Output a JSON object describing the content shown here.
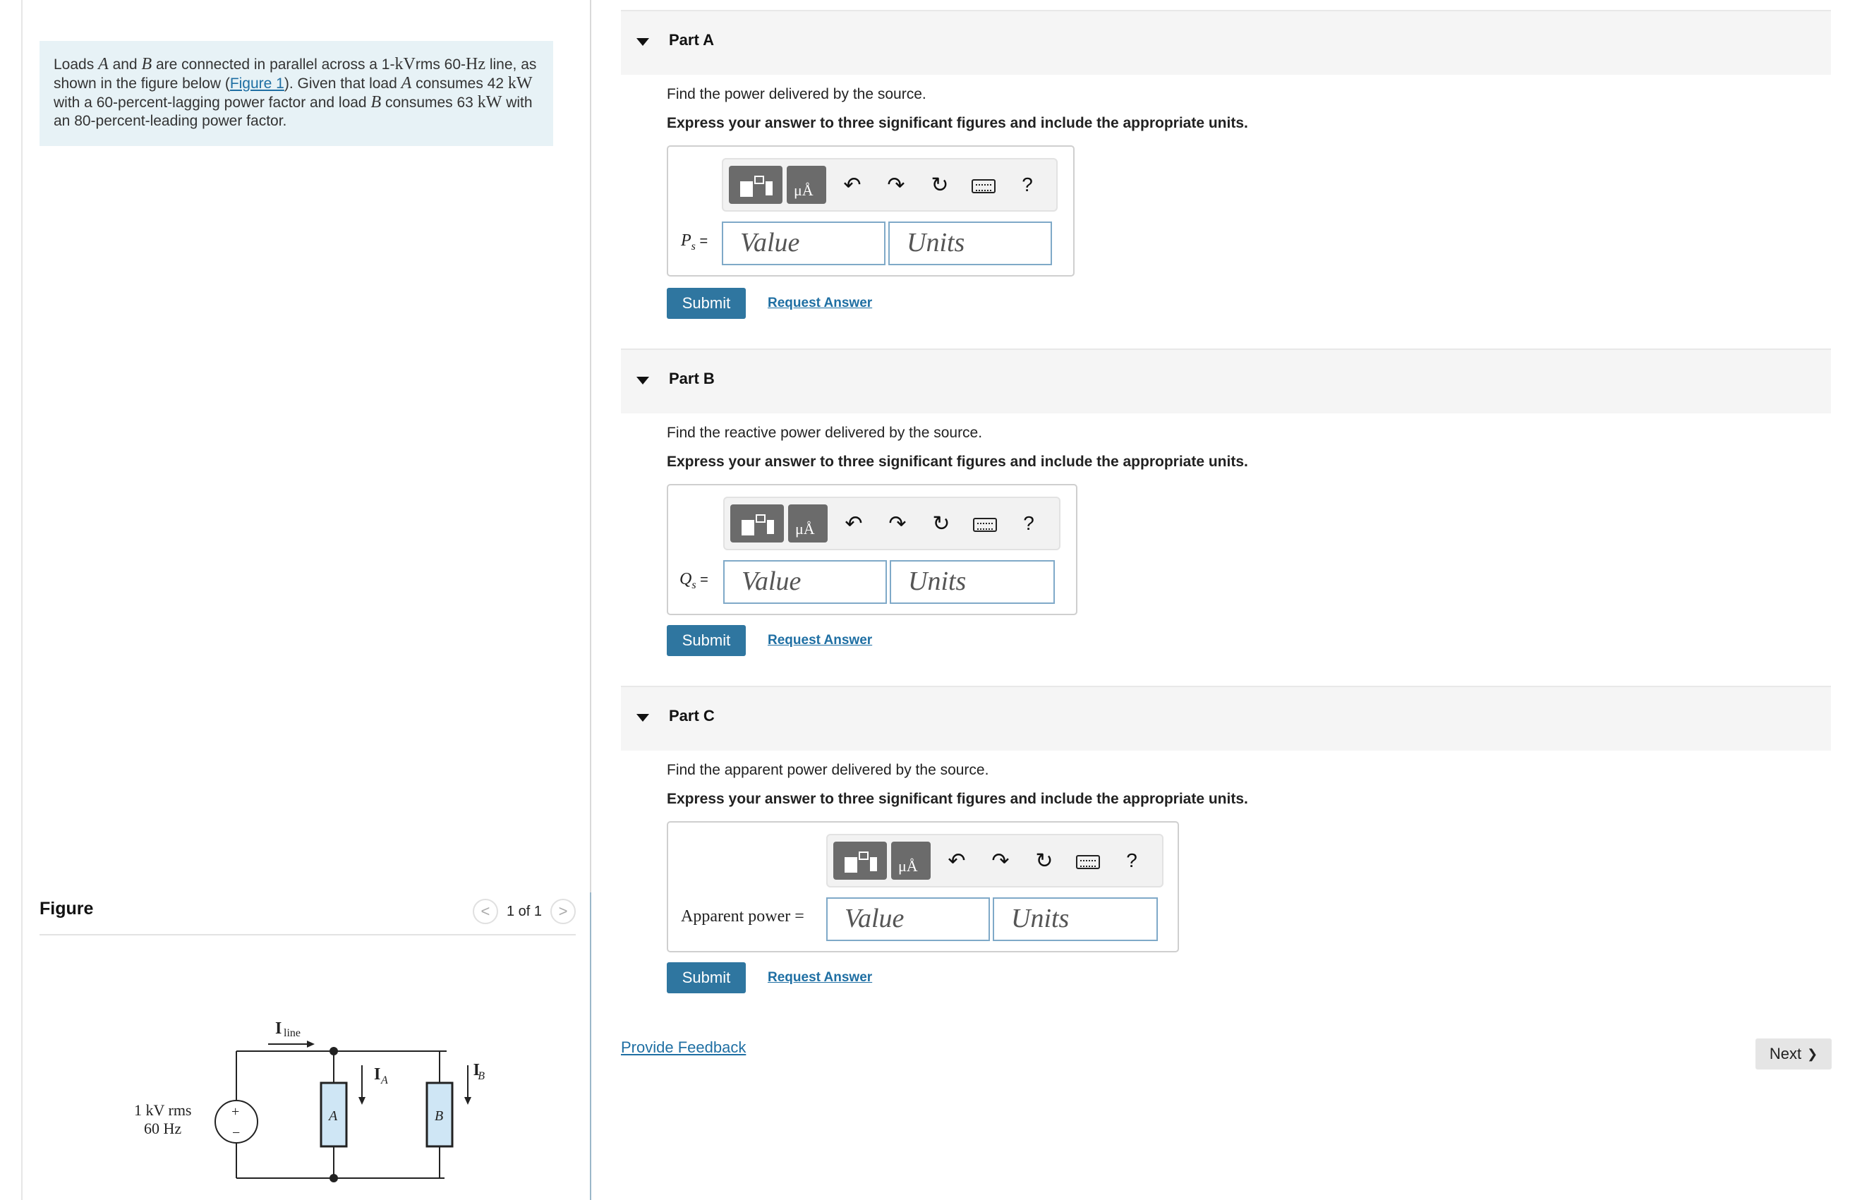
{
  "problem": {
    "t1": "Loads ",
    "A": "A",
    "t2": " and ",
    "B": "B",
    "t3": " are connected in parallel across a 1-",
    "kV": "kV",
    "t4": "rms 60-",
    "Hz": "Hz",
    "t5": " line, as shown in the figure below (",
    "figure_link": "Figure 1",
    "t6": "). Given that load ",
    "A2": "A",
    "t7": " consumes 42 ",
    "kW1": "kW",
    "t8": " with a 60-percent-lagging power factor and load ",
    "B2": "B",
    "t9": " consumes 63 ",
    "kW2": "kW",
    "t10": " with an 80-percent-leading power factor."
  },
  "figure": {
    "title": "Figure",
    "page": "1 of 1",
    "prev": "<",
    "next": ">"
  },
  "circuit": {
    "source_line1": "1 kV rms",
    "source_line2": "60 Hz",
    "plus": "+",
    "minus": "−",
    "iline": "I",
    "iline_sub": "line",
    "ia": "I",
    "ia_sub": "A",
    "ib": "I",
    "ib_sub": "B",
    "load_a": "A",
    "load_b": "B"
  },
  "parts": [
    {
      "title": "Part A",
      "question": "Find the power delivered by the source.",
      "instruction": "Express your answer to three significant figures and include the appropriate units.",
      "var": "P",
      "var_sub": "s",
      "eq": " =",
      "value_placeholder": "Value",
      "units_placeholder": "Units",
      "submit": "Submit",
      "request": "Request Answer"
    },
    {
      "title": "Part B",
      "question": "Find the reactive power delivered by the source.",
      "instruction": "Express your answer to three significant figures and include the appropriate units.",
      "var": "Q",
      "var_sub": "s",
      "eq": " =",
      "value_placeholder": "Value",
      "units_placeholder": "Units",
      "submit": "Submit",
      "request": "Request Answer"
    },
    {
      "title": "Part C",
      "question": "Find the apparent power delivered by the source.",
      "instruction": "Express your answer to three significant figures and include the appropriate units.",
      "var": "Apparent power =",
      "value_placeholder": "Value",
      "units_placeholder": "Units",
      "submit": "Submit",
      "request": "Request Answer"
    }
  ],
  "toolbar": {
    "mu": "μÅ",
    "undo": "↶",
    "redo": "↷",
    "reset": "↻",
    "help": "?"
  },
  "footer": {
    "feedback": "Provide Feedback",
    "next": "Next",
    "next_chevron": "❯"
  }
}
